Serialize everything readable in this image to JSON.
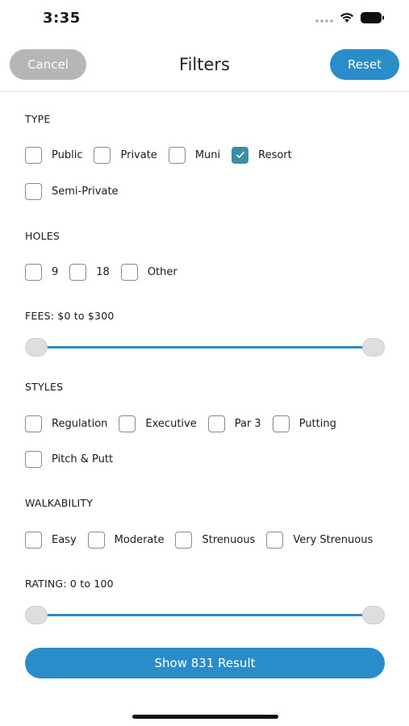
{
  "status_bar": {
    "time": "3:35"
  },
  "nav": {
    "cancel_label": "Cancel",
    "title": "Filters",
    "reset_label": "Reset"
  },
  "sections": {
    "type": {
      "label": "TYPE",
      "options": [
        {
          "label": "Public",
          "checked": false
        },
        {
          "label": "Private",
          "checked": false
        },
        {
          "label": "Muni",
          "checked": false
        },
        {
          "label": "Resort",
          "checked": true
        },
        {
          "label": "Semi-Private",
          "checked": false
        }
      ]
    },
    "holes": {
      "label": "HOLES",
      "options": [
        {
          "label": "9",
          "checked": false
        },
        {
          "label": "18",
          "checked": false
        },
        {
          "label": "Other",
          "checked": false
        }
      ]
    },
    "fees": {
      "label": "FEES: $0 to $300",
      "min": 0,
      "max": 300,
      "low": 0,
      "high": 300
    },
    "styles": {
      "label": "STYLES",
      "options": [
        {
          "label": "Regulation",
          "checked": false
        },
        {
          "label": "Executive",
          "checked": false
        },
        {
          "label": "Par 3",
          "checked": false
        },
        {
          "label": "Putting",
          "checked": false
        },
        {
          "label": "Pitch & Putt",
          "checked": false
        }
      ]
    },
    "walkability": {
      "label": "WALKABILITY",
      "options": [
        {
          "label": "Easy",
          "checked": false
        },
        {
          "label": "Moderate",
          "checked": false
        },
        {
          "label": "Strenuous",
          "checked": false
        },
        {
          "label": "Very Strenuous",
          "checked": false
        }
      ]
    },
    "rating": {
      "label": "RATING: 0 to 100",
      "min": 0,
      "max": 100,
      "low": 0,
      "high": 100
    }
  },
  "show_button": {
    "label": "Show 831 Result"
  },
  "colors": {
    "accent": "#2a8cc9",
    "checked": "#3a8fa5",
    "disabled": "#b6b6b6"
  }
}
